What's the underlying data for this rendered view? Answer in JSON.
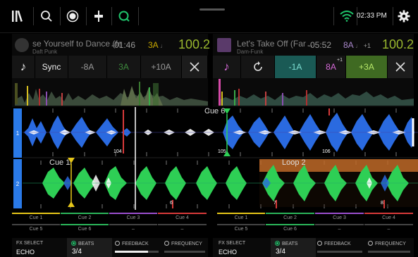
{
  "topbar": {
    "icons": [
      "library-icon",
      "search-icon",
      "record-icon",
      "levels-icon",
      "quantize-icon"
    ],
    "time": "02:33 PM",
    "wifi_color": "#1fc46b",
    "quantize_color": "#1fc46b"
  },
  "deck1": {
    "title": "se Yourself to Dance (fe",
    "artist": "Daft Punk",
    "time": "-01:46",
    "key": "3A",
    "bpm": "100.2",
    "controls": {
      "sync": "Sync",
      "key_minus": "-8A",
      "key_current": "3A",
      "key_plus": "+10A"
    }
  },
  "deck2": {
    "title": "Let's Take Off (Far ...",
    "artist": "Dam-Funk",
    "time": "-05:52",
    "key": "8A",
    "key_adjust": "+1",
    "bpm": "100.2",
    "controls": {
      "key_minus": "-1A",
      "key_current": "8A",
      "key_current_sup": "+1",
      "key_plus": "+3A"
    }
  },
  "waveforms": {
    "lane1_label": "1",
    "lane2_label": "2",
    "cue_top": "Cue 6",
    "cue_bottom": "Cue 1",
    "loop": "Loop 2",
    "beats_top": [
      "104",
      "105",
      "106"
    ],
    "beats_bottom": [
      "6",
      "7",
      "8"
    ]
  },
  "pads": {
    "deck1_row1": [
      "Cue 1",
      "Cue 2",
      "Cue 3",
      "Cue 4"
    ],
    "deck1_row2": [
      "Cue 5",
      "Cue 6",
      "–",
      "–"
    ],
    "deck2_row1": [
      "Cue 1",
      "Cue 2",
      "Cue 3",
      "Cue 4"
    ],
    "deck2_row2": [
      "Cue 5",
      "Cue 6",
      "–",
      "–"
    ],
    "colors": [
      "#e6c619",
      "#2bb55a",
      "#9b4fcf",
      "#d83a3a"
    ]
  },
  "fx1": {
    "select_label": "FX SELECT",
    "effect": "ECHO",
    "beats_label": "BEATS",
    "beats_value": "3/4",
    "feedback_label": "FEEDBACK",
    "frequency_label": "FREQUENCY",
    "feedback_level": 0.75
  },
  "fx2": {
    "select_label": "FX SELECT",
    "effect": "ECHO",
    "beats_label": "BEATS",
    "beats_value": "3/4",
    "feedback_label": "FEEDBACK",
    "frequency_label": "FREQUENCY",
    "feedback_level": 0.0
  }
}
